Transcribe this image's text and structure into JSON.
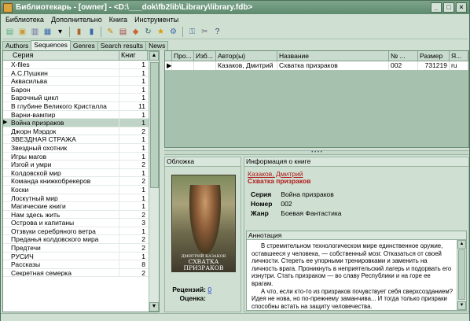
{
  "window": {
    "title": "Библиотекарь - [owner] - <D:\\___dok\\fb2lib\\Library\\library.fdb>"
  },
  "menu": [
    "Библиотека",
    "Дополнительно",
    "Книга",
    "Инструменты"
  ],
  "toolbar_icons": [
    "new-icon",
    "open-icon",
    "doc-icon",
    "add-icon",
    "dropdown-icon",
    "book-icon",
    "book2-icon",
    "read-icon",
    "edit-icon",
    "filter-icon",
    "refresh-icon",
    "star-icon",
    "settings-icon",
    "key-icon",
    "tools-icon",
    "help-icon"
  ],
  "tabs": [
    "Authors",
    "Sequences",
    "Genres",
    "Search results",
    "News"
  ],
  "active_tab": "Sequences",
  "series_list": {
    "col_name": "Серия",
    "col_count": "Книг",
    "rows": [
      {
        "name": "X-files",
        "count": "1"
      },
      {
        "name": "А.С.Пушкин",
        "count": "1"
      },
      {
        "name": "Аквасильва",
        "count": "1"
      },
      {
        "name": "Барон",
        "count": "1"
      },
      {
        "name": "Барочный цикл",
        "count": "1"
      },
      {
        "name": "В глубине Великого Кристалла",
        "count": "11"
      },
      {
        "name": "Варни-вампир",
        "count": "1"
      },
      {
        "name": "Война призраков",
        "count": "1",
        "selected": true
      },
      {
        "name": "Джорн Мэрдок",
        "count": "2"
      },
      {
        "name": "ЗВЕЗДНАЯ СТРАЖА",
        "count": "1"
      },
      {
        "name": "Звездный охотник",
        "count": "1"
      },
      {
        "name": "Игры магов",
        "count": "1"
      },
      {
        "name": "Изгой и умри",
        "count": "2"
      },
      {
        "name": "Колдовской мир",
        "count": "1"
      },
      {
        "name": "Команда книжкобрекеров",
        "count": "2"
      },
      {
        "name": "Коски",
        "count": "1"
      },
      {
        "name": "Лоскутный мир",
        "count": "1"
      },
      {
        "name": "Магические книги",
        "count": "1"
      },
      {
        "name": "Нам здесь жить",
        "count": "2"
      },
      {
        "name": "Острова и капитаны",
        "count": "3"
      },
      {
        "name": "Отзвуки серебряного ветра",
        "count": "1"
      },
      {
        "name": "Преданья колдовского мира",
        "count": "2"
      },
      {
        "name": "Предтечи",
        "count": "2"
      },
      {
        "name": "РУСИЧ",
        "count": "1"
      },
      {
        "name": "Рассказы",
        "count": "8"
      },
      {
        "name": "Секретная семерка",
        "count": "2"
      }
    ]
  },
  "books_table": {
    "headers": [
      "",
      "Про...",
      "Изб...",
      "Автор(ы)",
      "Название",
      "№ ...",
      "Размер",
      "Я..."
    ],
    "rows": [
      {
        "sel": "▶",
        "pro": "",
        "izb": "",
        "author": "Казаков, Дмитрий",
        "title": "Схватка призраков",
        "num": "002",
        "size": "731219",
        "lang": "ru"
      }
    ]
  },
  "cover_panel": {
    "header": "Обложка",
    "cover_author": "ДМИТРИЙ КАЗАКОВ",
    "cover_title": "СХВАТКА ПРИЗРАКОВ",
    "reviews_label": "Рецензий:",
    "reviews_value": "0",
    "rating_label": "Оценка:",
    "rating_value": ""
  },
  "info_panel": {
    "header": "Информация о книге",
    "author_link": "Казаков, Дмитрий",
    "book_title": "Схватка призраков",
    "series_label": "Серия",
    "series_value": "Война призраков",
    "number_label": "Номер",
    "number_value": "002",
    "genre_label": "Жанр",
    "genre_value": "Боевая Фантастика",
    "annotation_header": "Аннотация",
    "annotation_p1": "В стремительном технологическом мире единственное оружие, оставшееся у человека, — собственный мозг. Отказаться от своей личности. Стереть ее упорными тренировками и заменить на личность врага. Проникнуть в неприятельский лагерь и подорвать его изнутри. Стать призраком — во славу Республики и на горе ее врагам.",
    "annotation_p2": "А что, если кто-то из призраков почувствует себя сверхсозданием? Идея не нова, но по-прежнему заманчива... И тогда только призраки способны встать на защиту человечества."
  },
  "colors": {
    "title_bar": "#5e8a6e",
    "window_bg": "#cfe0d2",
    "link_red": "#b01818",
    "selection": "#bfd3c6"
  }
}
